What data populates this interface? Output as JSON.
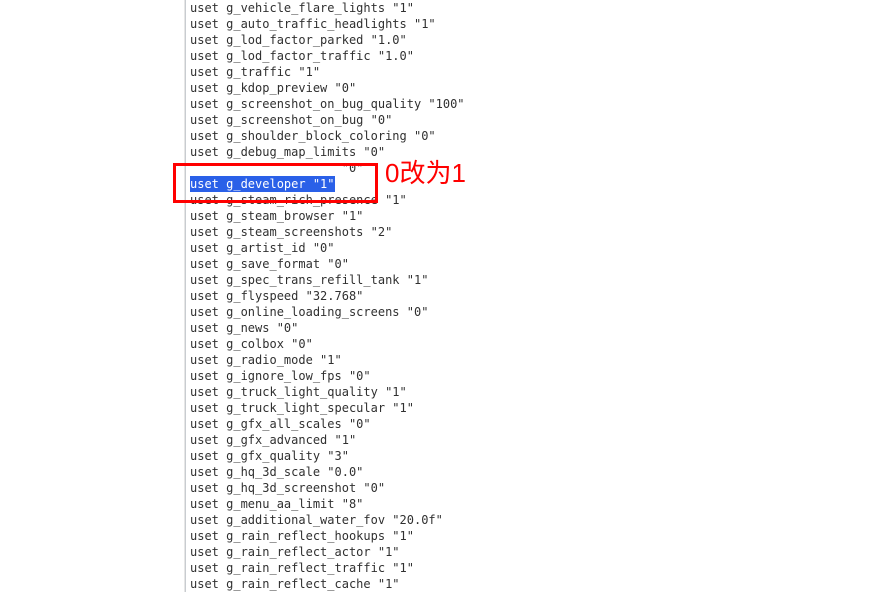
{
  "lines": [
    "uset g_vehicle_flare_lights \"1\"",
    "uset g_auto_traffic_headlights \"1\"",
    "uset g_lod_factor_parked \"1.0\"",
    "uset g_lod_factor_traffic \"1.0\"",
    "uset g_traffic \"1\"",
    "uset g_kdop_preview \"0\"",
    "uset g_screenshot_on_bug_quality \"100\"",
    "uset g_screenshot_on_bug \"0\"",
    "uset g_shoulder_block_coloring \"0\"",
    "uset g_debug_map_limits \"0\""
  ],
  "obscured_line_tail": "\"0\"",
  "highlighted": {
    "selected": "uset g_developer \"1\"",
    "rest": ""
  },
  "lines_after": [
    "uset g_steam_rich_presence \"1\"",
    "uset g_steam_browser \"1\"",
    "uset g_steam_screenshots \"2\"",
    "uset g_artist_id \"0\"",
    "uset g_save_format \"0\"",
    "uset g_spec_trans_refill_tank \"1\"",
    "uset g_flyspeed \"32.768\"",
    "uset g_online_loading_screens \"0\"",
    "uset g_news \"0\"",
    "uset g_colbox \"0\"",
    "uset g_radio_mode \"1\"",
    "uset g_ignore_low_fps \"0\"",
    "uset g_truck_light_quality \"1\"",
    "uset g_truck_light_specular \"1\"",
    "uset g_gfx_all_scales \"0\"",
    "uset g_gfx_advanced \"1\"",
    "uset g_gfx_quality \"3\"",
    "uset g_hq_3d_scale \"0.0\"",
    "uset g_hq_3d_screenshot \"0\"",
    "uset g_menu_aa_limit \"8\"",
    "uset g_additional_water_fov \"20.0f\"",
    "uset g_rain_reflect_hookups \"1\"",
    "uset g_rain_reflect_actor \"1\"",
    "uset g_rain_reflect_traffic \"1\"",
    "uset g_rain_reflect_cache \"1\""
  ],
  "annotation_text": "0改为1"
}
